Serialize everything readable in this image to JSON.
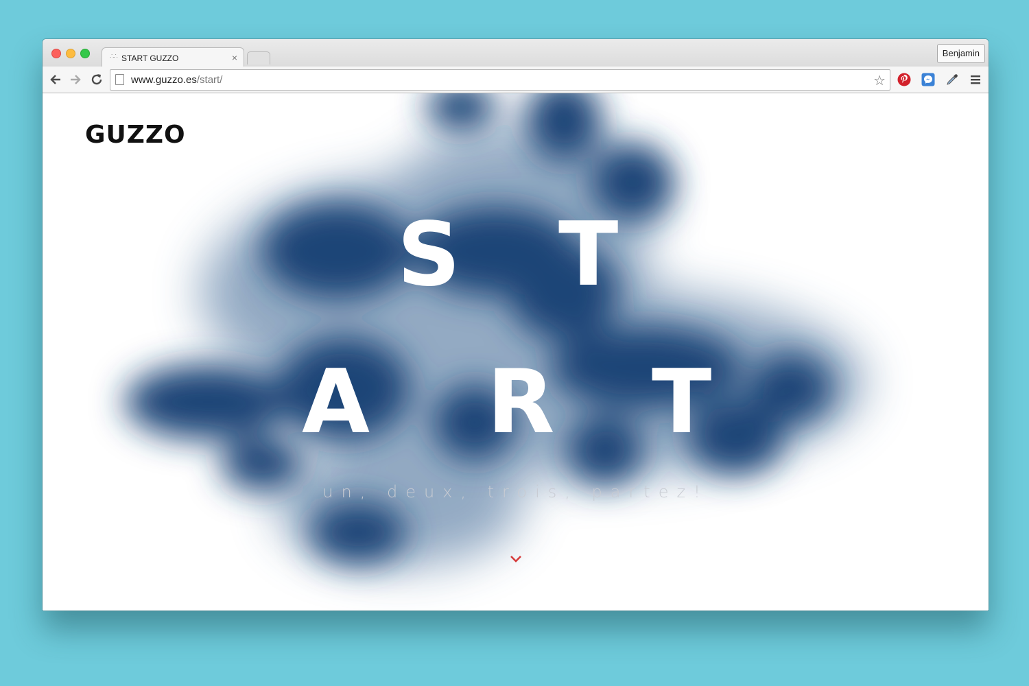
{
  "browser": {
    "tab_title": "START GUZZO",
    "tab_close": "×",
    "profile_name": "Benjamin",
    "url_domain": "www.guzzo.es",
    "url_path": "/start/"
  },
  "page": {
    "logo": "GUZZO",
    "letters": [
      "S",
      "T",
      "A",
      "R",
      "T"
    ],
    "tagline": "un, deux, trois, partez!"
  },
  "colors": {
    "ink_blue": "#1a4577",
    "scroll_arrow": "#d63b3b",
    "background": "#6ecbdb"
  },
  "icons": [
    "back-arrow",
    "forward-arrow",
    "reload",
    "bookmark-star",
    "pinterest",
    "messenger",
    "eyedropper",
    "menu"
  ]
}
